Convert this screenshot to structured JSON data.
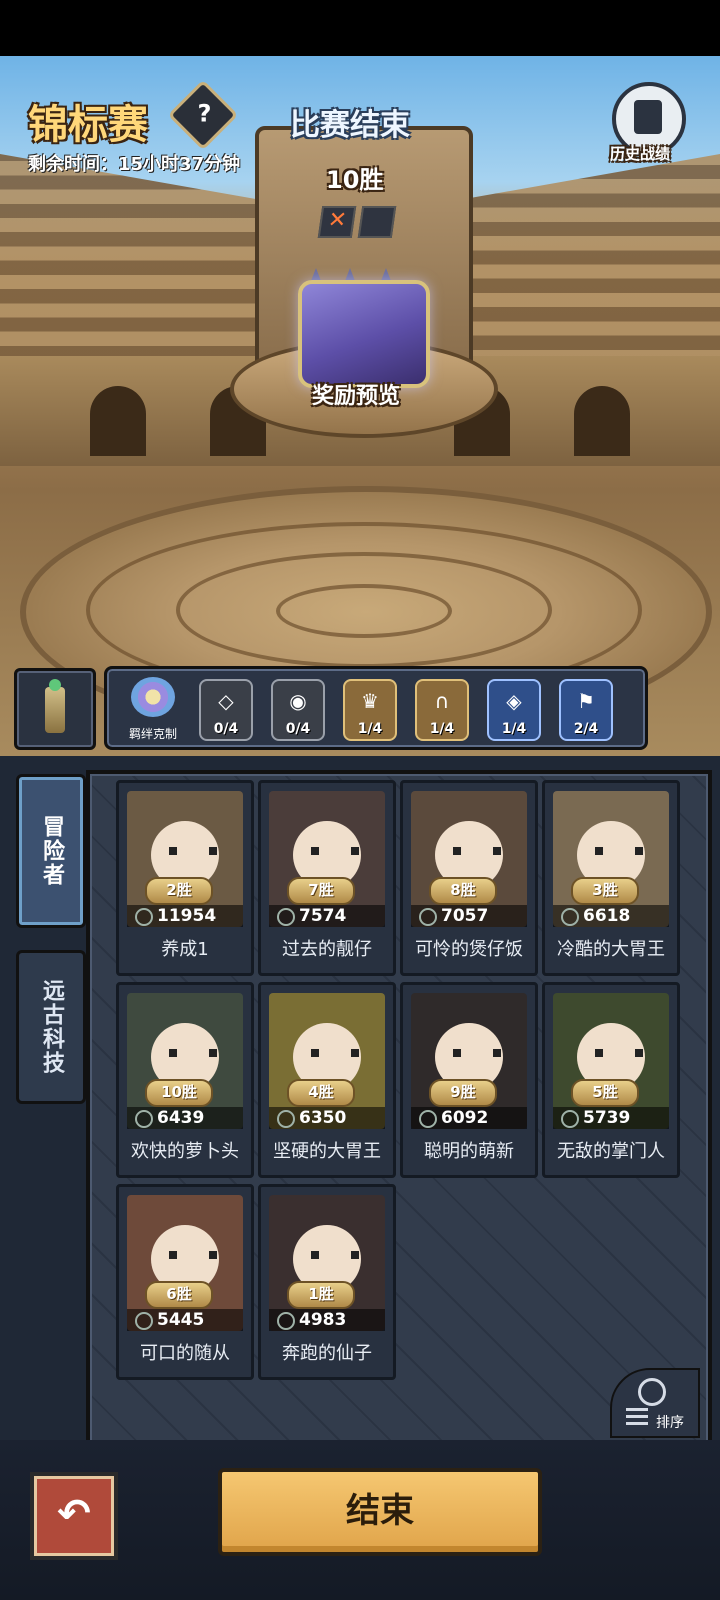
{
  "header": {
    "title": "锦标赛",
    "help_label": "?",
    "remaining_time": "剩余时间：15小时37分钟",
    "status": "比赛结束",
    "wins": "10胜",
    "loss_mark": "✕",
    "history_label": "历史战绩"
  },
  "reward": {
    "label": "奖励预览"
  },
  "bonds": {
    "main_label": "羁绊克制",
    "items": [
      {
        "count": "0/4",
        "style": "gray",
        "icon": "diamond-icon"
      },
      {
        "count": "0/4",
        "style": "gray",
        "icon": "eye-icon"
      },
      {
        "count": "1/4",
        "style": "gold",
        "icon": "crown-icon"
      },
      {
        "count": "1/4",
        "style": "gold",
        "icon": "horseshoe-icon"
      },
      {
        "count": "1/4",
        "style": "blue",
        "icon": "shield-icon"
      },
      {
        "count": "2/4",
        "style": "blue",
        "icon": "banner-icon"
      }
    ]
  },
  "tabs": [
    {
      "label": "冒险者",
      "active": true
    },
    {
      "label": "远古科技",
      "active": false
    }
  ],
  "heroes": [
    {
      "wins": "2胜",
      "power": "11954",
      "name": "养成1",
      "bg": "#6b5a44"
    },
    {
      "wins": "7胜",
      "power": "7574",
      "name": "过去的靓仔",
      "bg": "#4b3d3a"
    },
    {
      "wins": "8胜",
      "power": "7057",
      "name": "可怜的煲仔饭",
      "bg": "#5b4a3c"
    },
    {
      "wins": "3胜",
      "power": "6618",
      "name": "冷酷的大胃王",
      "bg": "#7a6a52"
    },
    {
      "wins": "10胜",
      "power": "6439",
      "name": "欢快的萝卜头",
      "bg": "#3f4a3f"
    },
    {
      "wins": "4胜",
      "power": "6350",
      "name": "坚硬的大胃王",
      "bg": "#7a6e34"
    },
    {
      "wins": "9胜",
      "power": "6092",
      "name": "聪明的萌新",
      "bg": "#2f2a2a"
    },
    {
      "wins": "5胜",
      "power": "5739",
      "name": "无敌的掌门人",
      "bg": "#3e4a2e"
    },
    {
      "wins": "6胜",
      "power": "5445",
      "name": "可口的随从",
      "bg": "#6e4a3a"
    },
    {
      "wins": "1胜",
      "power": "4983",
      "name": "奔跑的仙子",
      "bg": "#3a2f2f"
    }
  ],
  "sort_label": "排序",
  "back_label": "↶",
  "end_label": "结束"
}
